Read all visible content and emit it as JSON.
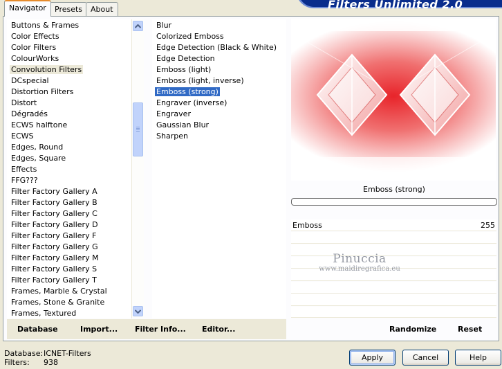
{
  "tabs": [
    {
      "label": "Navigator",
      "active": true
    },
    {
      "label": "Presets",
      "active": false
    },
    {
      "label": "About",
      "active": false
    }
  ],
  "app_title": "Filters Unlimited 2.0",
  "categories": {
    "items": [
      "Buttons & Frames",
      "Color Effects",
      "Color Filters",
      "ColourWorks",
      "Convolution Filters",
      "DCspecial",
      "Distortion Filters",
      "Distort",
      "Dégradés",
      "ECWS halftone",
      "ECWS",
      "Edges, Round",
      "Edges, Square",
      "Effects",
      "FFG???",
      "Filter Factory Gallery A",
      "Filter Factory Gallery B",
      "Filter Factory Gallery C",
      "Filter Factory Gallery D",
      "Filter Factory Gallery F",
      "Filter Factory Gallery G",
      "Filter Factory Gallery M",
      "Filter Factory Gallery S",
      "Filter Factory Gallery T",
      "Frames, Marble & Crystal",
      "Frames, Stone & Granite",
      "Frames, Textured"
    ],
    "highlighted_index": 4
  },
  "filters": {
    "items": [
      "Blur",
      "Colorized Emboss",
      "Edge Detection (Black & White)",
      "Edge Detection",
      "Emboss (light)",
      "Emboss (light, inverse)",
      "Emboss (strong)",
      "Engraver (inverse)",
      "Engraver",
      "Gaussian Blur",
      "Sharpen"
    ],
    "selected_index": 6
  },
  "bottom_left_buttons": {
    "database": "Database",
    "import": "Import...",
    "filter_info": "Filter Info...",
    "editor": "Editor..."
  },
  "preview": {
    "filter_name": "Emboss (strong)",
    "progress": 0
  },
  "parameters": [
    {
      "name": "Emboss",
      "value": "255"
    }
  ],
  "watermark": {
    "name": "Pinuccia",
    "site": "www.maidiregrafica.eu"
  },
  "right_buttons": {
    "randomize": "Randomize",
    "reset": "Reset"
  },
  "status": {
    "database_label": "Database:",
    "database_value": "ICNET-Filters",
    "filters_label": "Filters:",
    "filters_value": "938"
  },
  "dialog_buttons": {
    "apply": "Apply",
    "cancel": "Cancel",
    "help": "Help"
  },
  "colors": {
    "selection": "#316ac5",
    "banner": "#0a2d8c",
    "preview_red": "#e8242a"
  }
}
